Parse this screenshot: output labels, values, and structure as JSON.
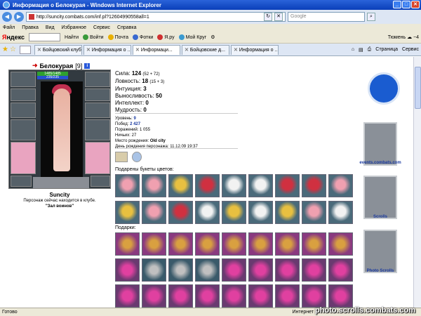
{
  "window": {
    "title": "Информация о Белокурая - Windows Internet Explorer",
    "min": "_",
    "max": "□",
    "close": "✕"
  },
  "address": {
    "url": "http://suncity.combats.com/inf.pl?12604990558all=1",
    "search_placeholder": "Google"
  },
  "menu": [
    "Файл",
    "Правка",
    "Вид",
    "Избранное",
    "Сервис",
    "Справка"
  ],
  "yandex": {
    "logo_prefix": "Я",
    "logo_suffix": "ндекс",
    "find": "Найти",
    "links": [
      "Войти",
      "Почта",
      "Фотки",
      "Я.ру",
      "Мой Круг"
    ],
    "weather": "Тюмень ☁ −4"
  },
  "tabs": [
    "Бойцовский клуб",
    "Информация о ...",
    "Информаци...",
    "Бойцовские д...",
    "Информация о ..."
  ],
  "toolbar": {
    "page": "Страница",
    "service": "Сервис"
  },
  "character": {
    "name": "Белокурая",
    "level": "[9]",
    "hp": "1485/1485",
    "mp": "235/235",
    "city": "Suncity",
    "club_text": "Персонаж сейчас находится в клубе.",
    "club_room": "\"Зал воинов\""
  },
  "stats": [
    {
      "label": "Сила:",
      "value": "124",
      "extra": "(52 + 72)"
    },
    {
      "label": "Ловкость:",
      "value": "18",
      "extra": "(15 + 3)"
    },
    {
      "label": "Интуиция:",
      "value": "3",
      "extra": ""
    },
    {
      "label": "Выносливость:",
      "value": "50",
      "extra": ""
    },
    {
      "label": "Интеллект:",
      "value": "0",
      "extra": ""
    },
    {
      "label": "Мудрость:",
      "value": "0",
      "extra": ""
    }
  ],
  "details": {
    "level_label": "Уровень:",
    "level_value": "9",
    "wins_label": "Побед:",
    "wins_value": "2 427",
    "losses_label": "Поражений:",
    "losses_value": "1 055",
    "draws_label": "Ничьих:",
    "draws_value": "27",
    "birthplace_label": "Место рождения:",
    "birthplace_value": "Old city",
    "birthday_label": "День рождения персонажа:",
    "birthday_value": "11.12.09 19:37"
  },
  "sections": {
    "bouquets": "Подарены букеты цветов:",
    "gifts": "Подарки:"
  },
  "sidebar": {
    "events": "events.combats.com",
    "scrolls": "Scrolls",
    "photo": "Photo Scrolls"
  },
  "status": {
    "text": "Готово",
    "zone": "Интернет"
  },
  "watermark": "photo.scrolls.combats.com"
}
